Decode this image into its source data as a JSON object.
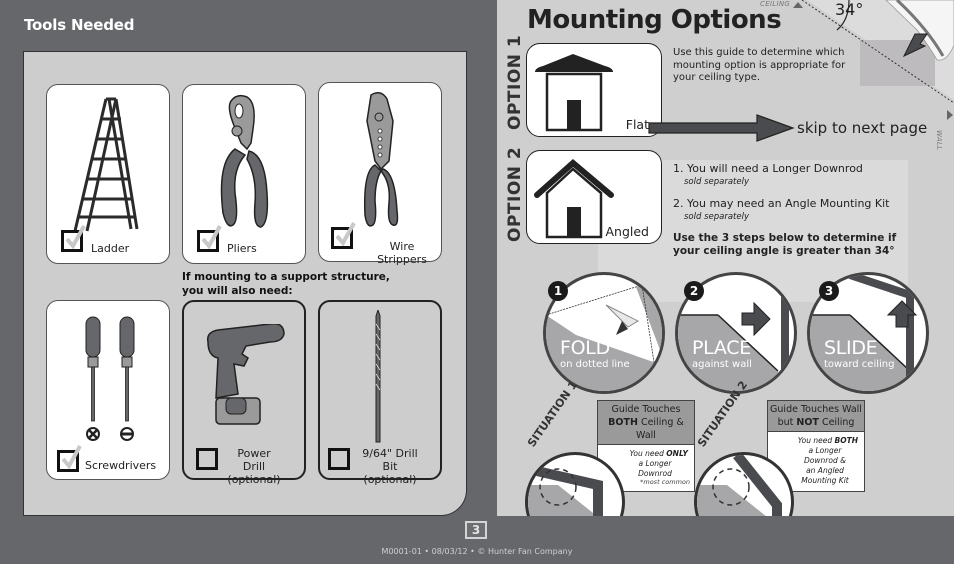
{
  "left_page": {
    "title": "Tools Needed",
    "support_note_line1": "If mounting to a support structure,",
    "support_note_line2": "you will also need:",
    "tools": [
      {
        "label": "Ladder",
        "checked": true,
        "optional": false,
        "icon": "ladder-icon"
      },
      {
        "label": "Pliers",
        "checked": true,
        "optional": false,
        "icon": "pliers-icon"
      },
      {
        "label": "Wire Strippers",
        "checked": true,
        "optional": false,
        "icon": "wire-strippers-icon"
      },
      {
        "label": "Screwdrivers",
        "checked": true,
        "optional": false,
        "icon": "screwdrivers-icon"
      },
      {
        "label": "Power Drill",
        "sublabel": "(optional)",
        "checked": false,
        "optional": true,
        "icon": "power-drill-icon"
      },
      {
        "label": "9/64\" Drill Bit",
        "sublabel": "(optional)",
        "checked": false,
        "optional": true,
        "icon": "drill-bit-icon"
      }
    ]
  },
  "right_page": {
    "title": "Mounting Options",
    "guide_corner": {
      "ceiling_label": "CEILING",
      "wall_label": "WALL",
      "angle": "34°"
    },
    "intro": "Use this guide to determine which mounting option is appropriate for your ceiling type.",
    "option1": {
      "label": "OPTION 1",
      "ceiling_type": "Flat",
      "action": "skip to next page"
    },
    "option2": {
      "label": "OPTION 2",
      "ceiling_type": "Angled",
      "items": [
        {
          "text": "1. You will need a Longer Downrod",
          "note": "sold separately"
        },
        {
          "text": "2. You may need an Angle Mounting Kit",
          "note": "sold separately"
        }
      ],
      "instruction_line1": "Use the 3 steps below to determine if",
      "instruction_line2": "your ceiling angle is greater than 34°"
    },
    "steps": [
      {
        "number": "1",
        "title": "FOLD",
        "subtitle": "on dotted line"
      },
      {
        "number": "2",
        "title": "PLACE",
        "subtitle": "against wall"
      },
      {
        "number": "3",
        "title": "SLIDE",
        "subtitle": "toward ceiling"
      }
    ],
    "situations": [
      {
        "label": "SITUATION 1",
        "head_line1": "Guide Touches",
        "head_bold": "BOTH",
        "head_line2": " Ceiling & Wall",
        "body_pre": "You need ",
        "body_bold": "ONLY",
        "body_lines": [
          "a Longer",
          "Downrod"
        ],
        "note": "*most common"
      },
      {
        "label": "SITUATION 2",
        "head_line1": "Guide Touches Wall",
        "head_pre": "but ",
        "head_bold": "NOT",
        "head_line2": " Ceiling",
        "body_pre": "You need ",
        "body_bold": "BOTH",
        "body_lines": [
          "a Longer",
          "Downrod &",
          "an Angled",
          "Mounting Kit"
        ]
      }
    ]
  },
  "footer": {
    "page_number": "3",
    "text": "M0001-01 • 08/03/12 • © Hunter Fan Company"
  },
  "colors": {
    "background_dark": "#66676b",
    "panel_light": "#cdcdcd",
    "inset_light": "#dadada",
    "accent_dark": "#4a4b4f"
  }
}
